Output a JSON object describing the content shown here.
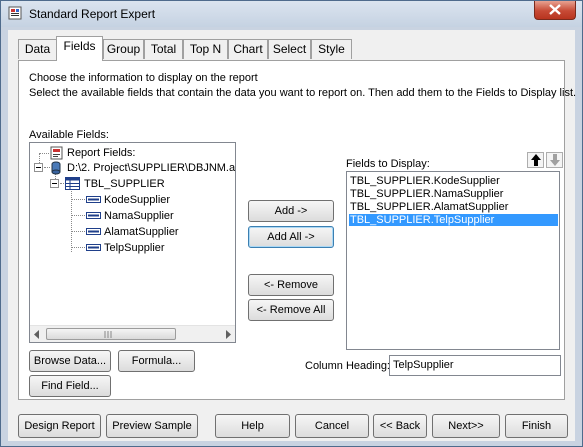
{
  "window": {
    "title": "Standard Report Expert"
  },
  "tabs": [
    {
      "label": "Data"
    },
    {
      "label": "Fields"
    },
    {
      "label": "Group"
    },
    {
      "label": "Total"
    },
    {
      "label": "Top N"
    },
    {
      "label": "Chart"
    },
    {
      "label": "Select"
    },
    {
      "label": "Style"
    }
  ],
  "instructions": {
    "line1": "Choose the information to display on the report",
    "line2": "Select the available fields that contain the data you want to report on.  Then add them to the Fields to Display list."
  },
  "available_fields": {
    "label": "Available Fields:",
    "tree": {
      "root": "Report Fields:",
      "database": "D:\\2. Project\\SUPPLIER\\DBJNM.a",
      "table": "TBL_SUPPLIER",
      "fields": [
        "KodeSupplier",
        "NamaSupplier",
        "AlamatSupplier",
        "TelpSupplier"
      ]
    }
  },
  "middle_buttons": {
    "add": "Add ->",
    "add_all": "Add All ->",
    "remove": "<- Remove",
    "remove_all": "<- Remove All"
  },
  "fields_to_display": {
    "label": "Fields to Display:",
    "items": [
      "TBL_SUPPLIER.KodeSupplier",
      "TBL_SUPPLIER.NamaSupplier",
      "TBL_SUPPLIER.AlamatSupplier",
      "TBL_SUPPLIER.TelpSupplier"
    ],
    "selected_index": 3
  },
  "left_buttons": {
    "browse": "Browse Data...",
    "formula": "Formula...",
    "find": "Find Field..."
  },
  "column_heading": {
    "label": "Column Heading:",
    "value": "TelpSupplier"
  },
  "bottom_buttons": {
    "design": "Design Report",
    "preview": "Preview Sample",
    "help": "Help",
    "cancel": "Cancel",
    "back": "<< Back",
    "next": "Next>>",
    "finish": "Finish"
  }
}
